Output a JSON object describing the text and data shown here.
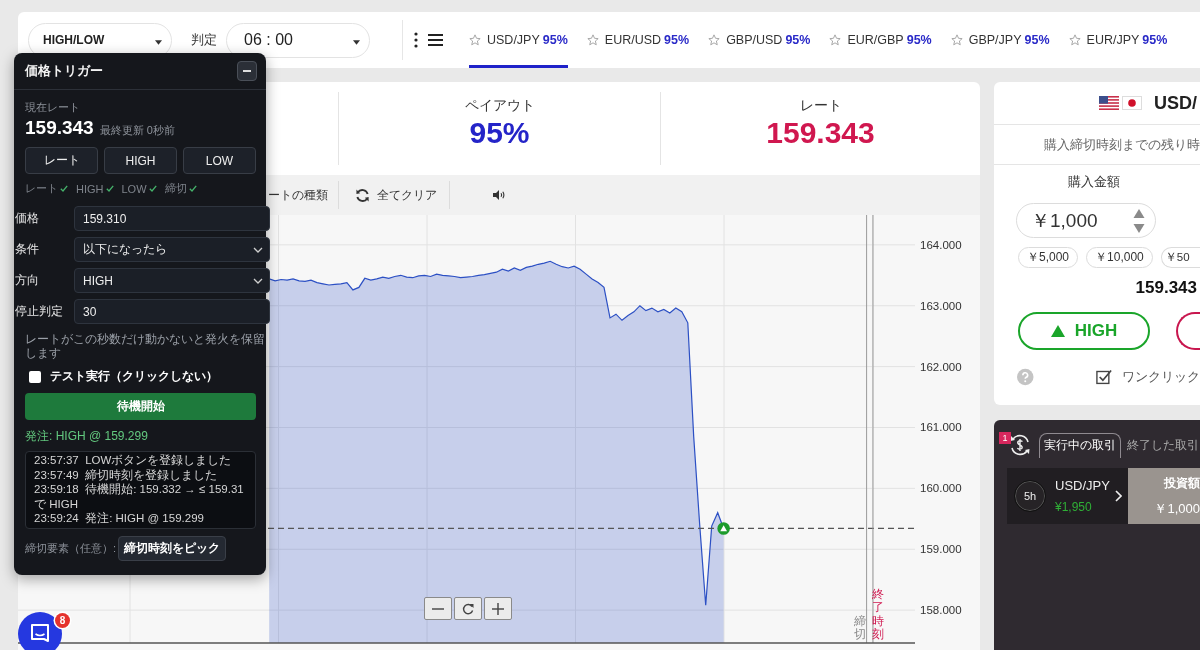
{
  "top_bar": {
    "trade_type": "HIGH/LOW",
    "judgement_label": "判定",
    "judgement_time": "06 : 00",
    "pair_tabs": [
      {
        "pair": "USD/JPY",
        "payout": "95%",
        "selected": true
      },
      {
        "pair": "EUR/USD",
        "payout": "95%",
        "selected": false
      },
      {
        "pair": "GBP/USD",
        "payout": "95%",
        "selected": false
      },
      {
        "pair": "EUR/GBP",
        "payout": "95%",
        "selected": false
      },
      {
        "pair": "GBP/JPY",
        "payout": "95%",
        "selected": false
      },
      {
        "pair": "EUR/JPY",
        "payout": "95%",
        "selected": false
      }
    ]
  },
  "trigger_panel": {
    "title": "価格トリガー",
    "rate_label": "現在レート",
    "rate": "159.343",
    "updated": "最終更新 0秒前",
    "register_buttons": [
      "レート",
      "HIGH",
      "LOW"
    ],
    "registered": [
      {
        "label": "レート",
        "done": true
      },
      {
        "label": "HIGH",
        "done": true
      },
      {
        "label": "LOW",
        "done": true
      },
      {
        "label": "締切",
        "done": true
      }
    ],
    "fields": [
      {
        "label": "価格",
        "kind": "input",
        "value": "159.310"
      },
      {
        "label": "条件",
        "kind": "select",
        "value": "以下になったら"
      },
      {
        "label": "方向",
        "kind": "select",
        "value": "HIGH"
      },
      {
        "label": "停止判定",
        "kind": "input",
        "value": "30"
      }
    ],
    "hint": "レートがこの秒数だけ動かないと発火を保留します",
    "test_run": {
      "label": "テスト実行（クリックしない）",
      "checked": false
    },
    "start_button": "待機開始",
    "order_status": "発注: HIGH @ 159.299",
    "log": [
      "23:57:37  LOWボタンを登録しました",
      "23:57:49  締切時刻を登録しました",
      "23:59:18  待機開始: 159.332 → ≤ 159.31 で HIGH",
      "23:59:24  発注: HIGH @ 159.299"
    ],
    "deadline_label": "締切要素（任意）:",
    "pick_button": "締切時刻をピック"
  },
  "info_strip": {
    "payout_label": "ペイアウト",
    "payout": "95%",
    "rate_label": "レート",
    "rate": "159.343"
  },
  "chart_toolbar": {
    "chart_type": "ートの種類",
    "clear": "全てクリア"
  },
  "chart": {
    "chart_data": [
      {
        "type": "area",
        "color": "#2c50c4",
        "grid": true,
        "tick_labels": "y",
        "ylim": [
          157.46,
          164.49
        ],
        "yticks": [
          {
            "value": 164,
            "label": "164.000"
          },
          {
            "value": 163,
            "label": "163.000"
          },
          {
            "value": 162,
            "label": "162.000"
          },
          {
            "value": 161,
            "label": "161.000"
          },
          {
            "value": 160,
            "label": "160.000"
          },
          {
            "value": 159,
            "label": "159.000"
          },
          {
            "value": 158,
            "label": "158.000"
          }
        ],
        "values": [
          null,
          null,
          null,
          null,
          null,
          null,
          null,
          null,
          null,
          null,
          null,
          null,
          null,
          null,
          null,
          null,
          null,
          null,
          null,
          null,
          null,
          null,
          null,
          null,
          null,
          null,
          null,
          null,
          null,
          null,
          null,
          null,
          null,
          null,
          null,
          null,
          null,
          null,
          null,
          null,
          null,
          null,
          163.44,
          163.41,
          163.43,
          163.42,
          163.44,
          163.41,
          163.4,
          163.42,
          163.38,
          163.36,
          163.34,
          163.35,
          163.36,
          163.38,
          163.26,
          163.3,
          163.45,
          163.42,
          163.44,
          163.47,
          163.45,
          163.48,
          163.5,
          163.47,
          163.46,
          163.49,
          163.5,
          163.48,
          163.52,
          163.5,
          163.49,
          163.48,
          163.46,
          163.47,
          163.48,
          163.5,
          163.51,
          163.53,
          163.55,
          163.6,
          163.57,
          163.62,
          163.58,
          163.63,
          163.65,
          163.68,
          163.7,
          163.73,
          163.68,
          163.64,
          163.62,
          163.65,
          163.6,
          163.52,
          163.44,
          163.38,
          163.3,
          162.8,
          162.86,
          162.76,
          162.84,
          162.9,
          163.0,
          162.92,
          162.96,
          162.9,
          162.94,
          162.88,
          162.96,
          162.9,
          162.72,
          160.85,
          159.4,
          158.08,
          159.38,
          159.6,
          159.34,
          null,
          null,
          null,
          null,
          null,
          null,
          null,
          null,
          null,
          null,
          null,
          null,
          null,
          null,
          null,
          null,
          null,
          null,
          null,
          null,
          null,
          null,
          null,
          null,
          null,
          null,
          null,
          null,
          null,
          null,
          null,
          null
        ],
        "ref_lines": [
          {
            "axis": "y",
            "value": 159.343,
            "color": "#555555",
            "line_style": "dashed"
          }
        ]
      }
    ],
    "time_markers": [
      {
        "kind": "deadline",
        "label": "締切"
      },
      {
        "kind": "end",
        "label": "終了時刻"
      }
    ]
  },
  "trade_panel": {
    "pair": "USD/",
    "countdown_label": "購入締切時刻までの残り時",
    "amount_label": "購入金額",
    "amount": "￥1,000",
    "presets": [
      "￥5,000",
      "￥10,000",
      "￥50"
    ],
    "rate": "159.343",
    "high_button": "HIGH",
    "one_click": {
      "label": "ワンクリック",
      "checked": true
    }
  },
  "positions_panel": {
    "badge": "1",
    "tabs": [
      {
        "label": "実行中の取引",
        "selected": true
      },
      {
        "label": "終了した取引",
        "selected": false
      }
    ],
    "trade": {
      "timer": "5h",
      "pair": "USD/JPY",
      "payout": "¥1,950",
      "invest_label": "投資額",
      "invest": "￥1,000"
    }
  },
  "chat": {
    "badge": "8"
  }
}
